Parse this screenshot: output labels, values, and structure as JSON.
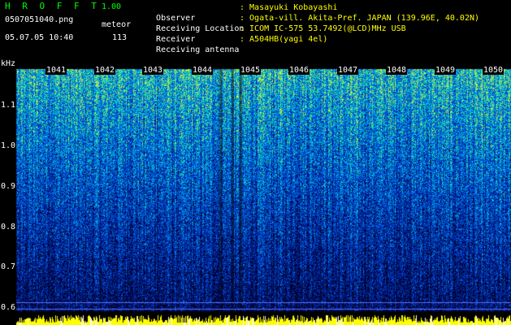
{
  "header": {
    "app_name": "H R O F F T",
    "version": "1.00",
    "filename": "0507051040.png",
    "mode": "meteor",
    "datetime": "05.07.05 10:40",
    "count": "113"
  },
  "meta": [
    {
      "key": "Observer",
      "value": ": Masayuki Kobayashi"
    },
    {
      "key": "Receiving Location",
      "value": ": Ogata-vill. Akita-Pref. JAPAN (139.96E, 40.02N)"
    },
    {
      "key": "Receiver",
      "value": ": ICOM IC-575 53.7492(@LCD)MHz USB"
    },
    {
      "key": "Receiving antenna",
      "value": ": A504HB(yagi 4el)"
    }
  ],
  "axis": {
    "y_unit": "kHz",
    "y_ticks": [
      "1.1",
      "1.0",
      "0.9",
      "0.8",
      "0.7",
      "0.6"
    ],
    "x_ticks": [
      "1041",
      "1042",
      "1043",
      "1044",
      "1045",
      "1046",
      "1047",
      "1048",
      "1049",
      "1050"
    ]
  },
  "colors": {
    "bg": "#000000",
    "title": "#00ff00",
    "value": "#ffff00",
    "text": "#ffffff"
  }
}
